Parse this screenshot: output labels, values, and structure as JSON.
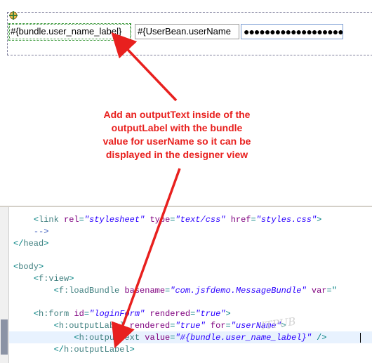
{
  "design_view": {
    "output_label_text": "#{bundle.user_name_label}",
    "input_text_value": "#{UserBean.userName",
    "password_value": "●●●●●●●●●●●●●●●●●●●●"
  },
  "annotation": {
    "line1": "Add an outputText inside of the",
    "line2": "outputLabel with the bundle",
    "line3": "value for userName so it can be",
    "line4": "displayed in the designer view",
    "arrow_color": "#e8201e"
  },
  "editor": {
    "lines": [
      {
        "indent": "    ",
        "parts": [
          [
            "sym",
            "<"
          ],
          [
            "tag",
            "link "
          ],
          [
            "att",
            "rel"
          ],
          [
            "sym",
            "="
          ],
          [
            "val",
            "\"stylesheet\""
          ],
          [
            "att",
            " type"
          ],
          [
            "sym",
            "="
          ],
          [
            "val",
            "\"text/css\""
          ],
          [
            "att",
            " href"
          ],
          [
            "sym",
            "="
          ],
          [
            "val",
            "\"styles.css\""
          ],
          [
            "sym",
            ">"
          ]
        ]
      },
      {
        "indent": "    ",
        "parts": [
          [
            "com",
            "-->"
          ]
        ]
      },
      {
        "indent": "",
        "parts": [
          [
            "sym",
            "</"
          ],
          [
            "tag",
            "head"
          ],
          [
            "sym",
            ">"
          ]
        ]
      },
      {
        "indent": "",
        "parts": []
      },
      {
        "indent": "",
        "parts": [
          [
            "sym",
            "<"
          ],
          [
            "tag",
            "body"
          ],
          [
            "sym",
            ">"
          ]
        ]
      },
      {
        "indent": "    ",
        "parts": [
          [
            "sym",
            "<"
          ],
          [
            "tag",
            "f:view"
          ],
          [
            "sym",
            ">"
          ]
        ]
      },
      {
        "indent": "        ",
        "parts": [
          [
            "sym",
            "<"
          ],
          [
            "tag",
            "f:loadBundle "
          ],
          [
            "att",
            "basename"
          ],
          [
            "sym",
            "="
          ],
          [
            "val",
            "\"com.jsfdemo.MessageBundle\""
          ],
          [
            "att",
            " var"
          ],
          [
            "sym",
            "=\""
          ]
        ]
      },
      {
        "indent": "",
        "parts": []
      },
      {
        "indent": "    ",
        "parts": [
          [
            "sym",
            "<"
          ],
          [
            "tag",
            "h:form "
          ],
          [
            "att",
            "id"
          ],
          [
            "sym",
            "="
          ],
          [
            "val",
            "\"loginForm\""
          ],
          [
            "att",
            " rendered"
          ],
          [
            "sym",
            "="
          ],
          [
            "val",
            "\"true\""
          ],
          [
            "sym",
            ">"
          ]
        ]
      },
      {
        "indent": "        ",
        "parts": [
          [
            "sym",
            "<"
          ],
          [
            "tag",
            "h:outputLabel "
          ],
          [
            "att",
            "rendered"
          ],
          [
            "sym",
            "="
          ],
          [
            "val",
            "\"true\""
          ],
          [
            "att",
            " for"
          ],
          [
            "sym",
            "="
          ],
          [
            "val",
            "\"userName\""
          ],
          [
            "sym",
            ">"
          ]
        ]
      },
      {
        "indent": "            ",
        "parts": [
          [
            "sym",
            "<"
          ],
          [
            "tag",
            "h:outputText "
          ],
          [
            "att",
            "value"
          ],
          [
            "sym",
            "="
          ],
          [
            "val",
            "\"#{bundle.user_name_label}\""
          ],
          [
            "sym",
            " />"
          ]
        ]
      },
      {
        "indent": "        ",
        "parts": [
          [
            "sym",
            "</"
          ],
          [
            "tag",
            "h:outputLabel"
          ],
          [
            "sym",
            ">"
          ]
        ]
      }
    ]
  },
  "watermark": "ITPUB"
}
